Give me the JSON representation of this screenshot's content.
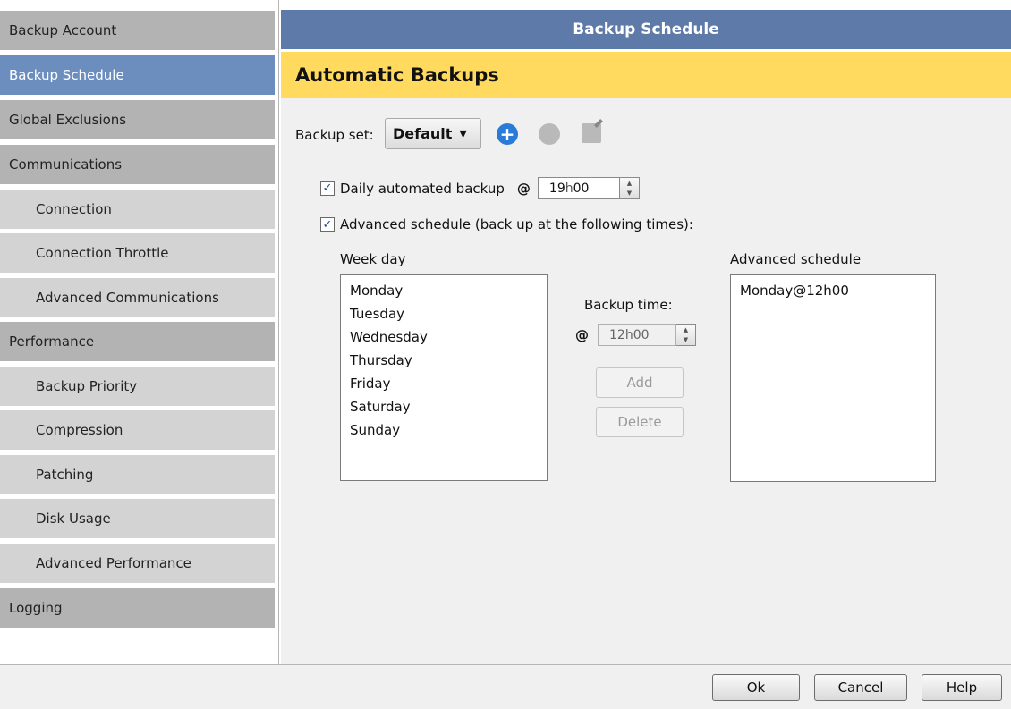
{
  "sidebar": {
    "items": [
      {
        "label": "Backup Account"
      },
      {
        "label": "Backup Schedule"
      },
      {
        "label": "Global Exclusions"
      },
      {
        "label": "Communications"
      },
      {
        "label": "Connection"
      },
      {
        "label": "Connection Throttle"
      },
      {
        "label": "Advanced Communications"
      },
      {
        "label": "Performance"
      },
      {
        "label": "Backup Priority"
      },
      {
        "label": "Compression"
      },
      {
        "label": "Patching"
      },
      {
        "label": "Disk Usage"
      },
      {
        "label": "Advanced Performance"
      },
      {
        "label": "Logging"
      }
    ]
  },
  "header": {
    "title": "Backup Schedule"
  },
  "section": {
    "title": "Automatic Backups"
  },
  "backup_set": {
    "label": "Backup set:",
    "value": "Default"
  },
  "daily": {
    "checked": true,
    "label": "Daily automated backup",
    "at": "@",
    "hour": "19",
    "h": "h",
    "minute": "00"
  },
  "advanced": {
    "checked": true,
    "label": "Advanced schedule (back up at the following times):"
  },
  "weekday": {
    "header": "Week day",
    "items": [
      "Monday",
      "Tuesday",
      "Wednesday",
      "Thursday",
      "Friday",
      "Saturday",
      "Sunday"
    ]
  },
  "backup_time": {
    "label": "Backup time:",
    "at": "@",
    "hour": "12",
    "h": "h",
    "minute": "00"
  },
  "buttons": {
    "add": "Add",
    "delete": "Delete"
  },
  "schedule": {
    "header": "Advanced schedule",
    "items": [
      "Monday@12h00"
    ]
  },
  "footer": {
    "ok": "Ok",
    "cancel": "Cancel",
    "help": "Help"
  },
  "colors": {
    "header_bg": "#5d7aa8",
    "subheader_bg": "#ffda5e",
    "active_item": "#6c8ebf",
    "accent_blue": "#2a7bd8"
  }
}
